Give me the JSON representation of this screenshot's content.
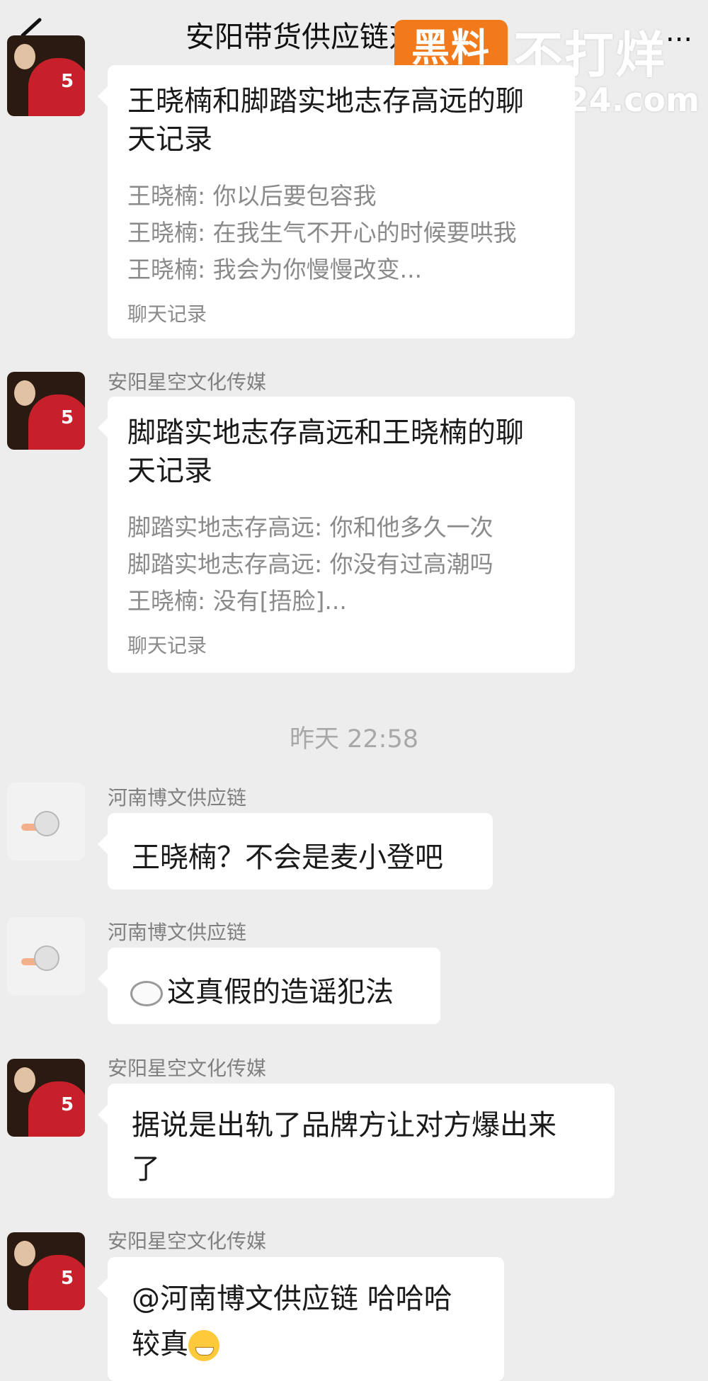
{
  "header": {
    "title": "安阳带货供应链对接群（",
    "more": "...",
    "watermark_badge": "黑料",
    "watermark_text": "不打烊",
    "watermark_url": "heiliaobb24.com"
  },
  "messages": [
    {
      "record_title_l1": "王晓楠和脚踏实地志存高远的聊",
      "record_title_l2": "天记录",
      "lines": [
        "王晓楠: 你以后要包容我",
        "王晓楠: 在我生气不开心的时候要哄我",
        "王晓楠: 我会为你慢慢改变..."
      ],
      "footer": "聊天记录"
    },
    {
      "sender": "安阳星空文化传媒",
      "record_title_l1": "脚踏实地志存高远和王晓楠的聊",
      "record_title_l2": "天记录",
      "lines": [
        "脚踏实地志存高远: 你和他多久一次",
        "脚踏实地志存高远: 你没有过高潮吗",
        "王晓楠: 没有[捂脸]..."
      ],
      "footer": "聊天记录"
    }
  ],
  "timestamp": "昨天 22:58",
  "chat": [
    {
      "sender": "河南博文供应链",
      "text": "王晓楠？不会是麦小登吧"
    },
    {
      "sender": "河南博文供应链",
      "text": "这真假的造谣犯法"
    },
    {
      "sender": "安阳星空文化传媒",
      "text_l1": "据说是出轨了品牌方让对方爆出来",
      "text_l2": "了"
    },
    {
      "sender": "安阳星空文化传媒",
      "text_l1": "@河南博文供应链 哈哈哈",
      "text_l2": "较真"
    }
  ]
}
